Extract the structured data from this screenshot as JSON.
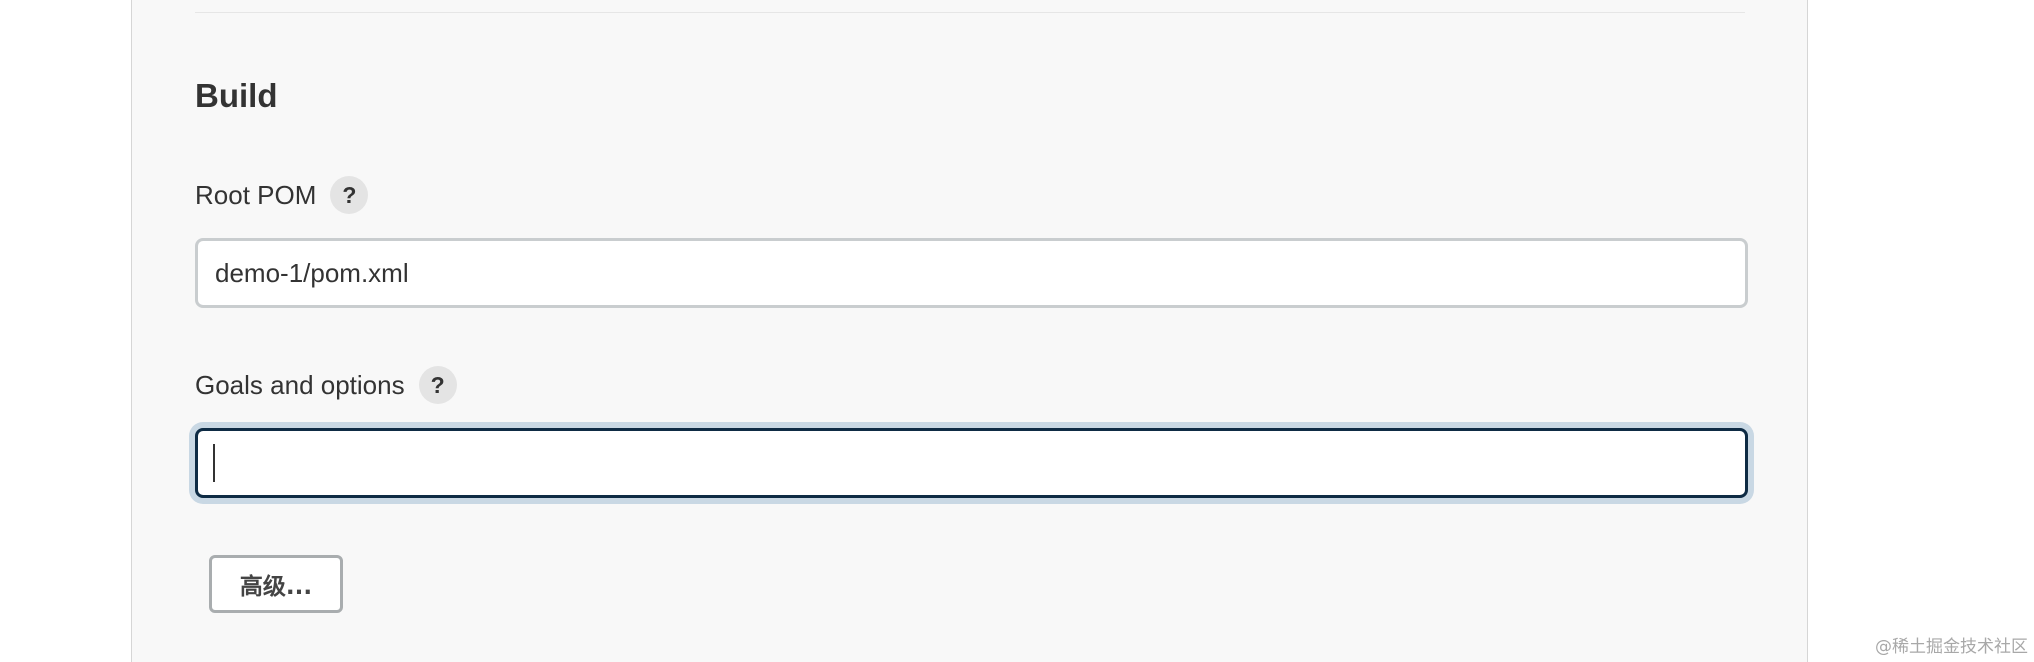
{
  "section": {
    "title": "Build"
  },
  "root_pom": {
    "label": "Root POM",
    "help": "?",
    "value": "demo-1/pom.xml"
  },
  "goals": {
    "label": "Goals and options",
    "help": "?",
    "value": ""
  },
  "advanced_button": {
    "label": "高级..."
  },
  "watermark": {
    "text": "@稀土掘金技术社区"
  },
  "colors": {
    "panel_background": "#f8f8f8",
    "focus_border": "#0e2b44",
    "focus_ring": "#c9d8e4"
  },
  "icons": [
    "help-icon"
  ]
}
